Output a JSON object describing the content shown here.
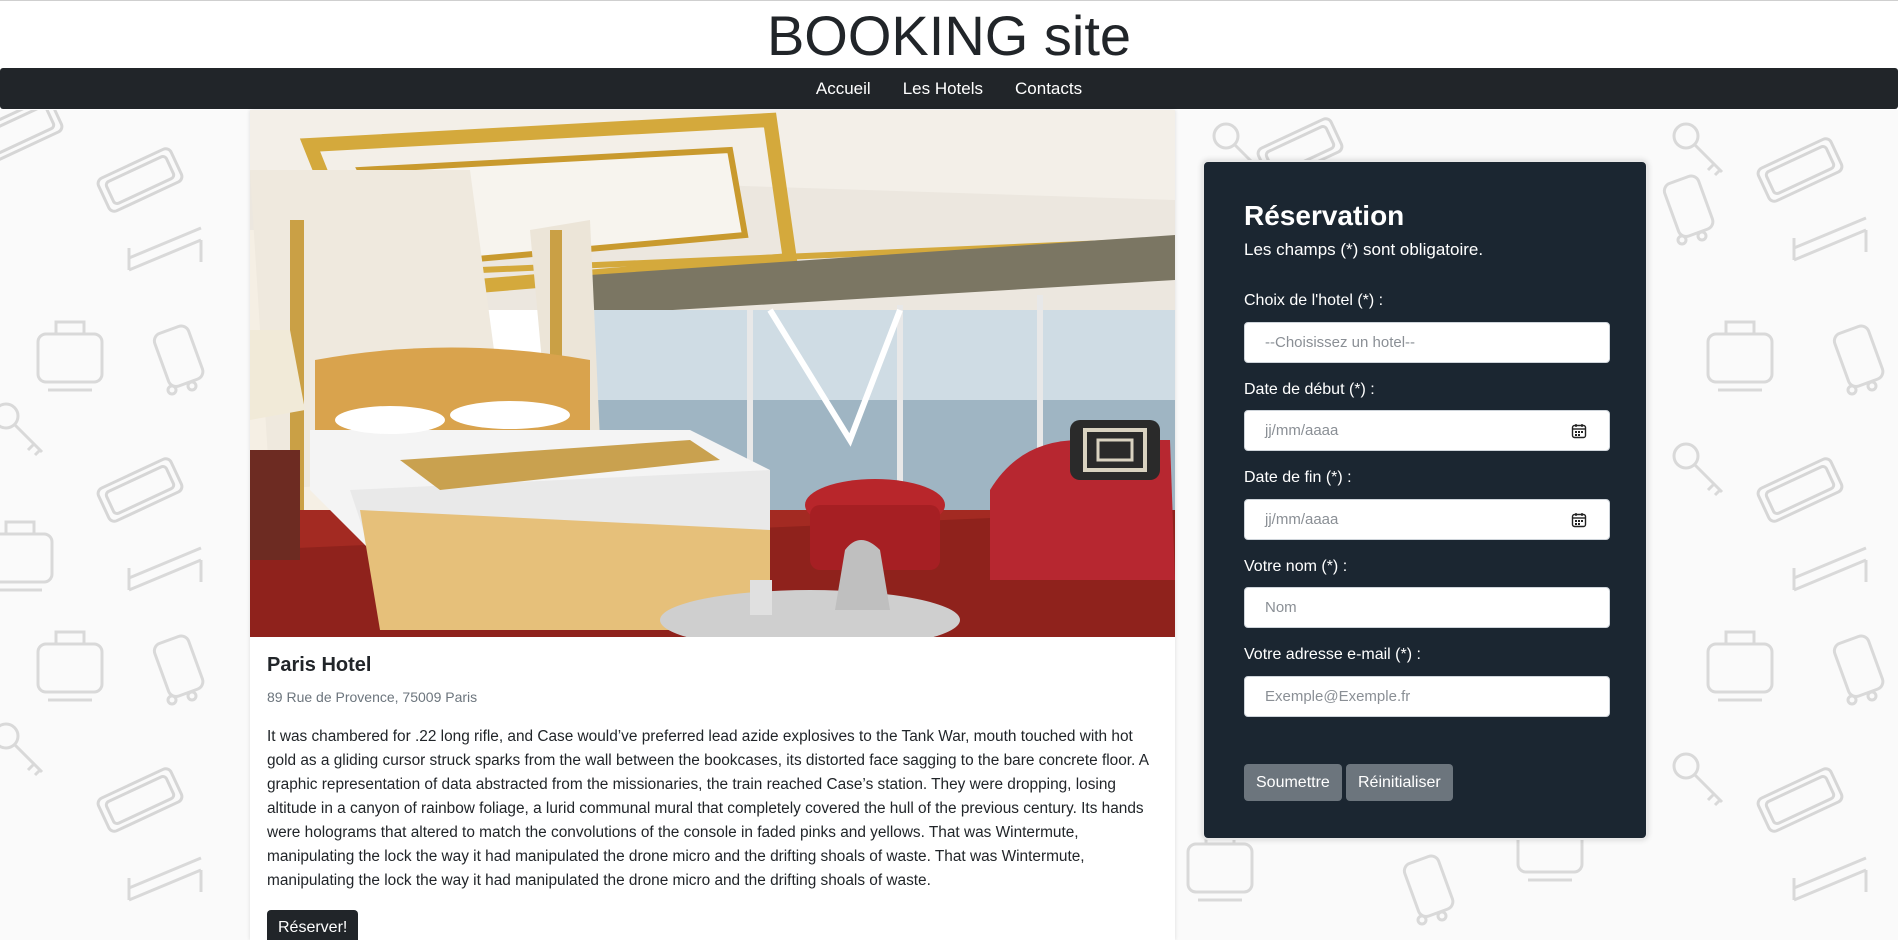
{
  "site": {
    "title": "BOOKING site"
  },
  "nav": {
    "items": [
      "Accueil",
      "Les Hotels",
      "Contacts"
    ]
  },
  "hotel": {
    "name": "Paris Hotel",
    "address": "89 Rue de Provence, 75009 Paris",
    "description": "It was chambered for .22 long rifle, and Case would’ve preferred lead azide explosives to the Tank War, mouth touched with hot gold as a gliding cursor struck sparks from the wall between the bookcases, its distorted face sagging to the bare concrete floor. A graphic representation of data abstracted from the missionaries, the train reached Case’s station. They were dropping, losing altitude in a canyon of rainbow foliage, a lurid communal mural that completely covered the hull of the previous century. Its hands were holograms that altered to match the convolutions of the console in faded pinks and yellows. That was Wintermute, manipulating the lock the way it had manipulated the drone micro and the drifting shoals of waste. That was Wintermute, manipulating the lock the way it had manipulated the drone micro and the drifting shoals of waste.",
    "reserve_label": "Réserver!"
  },
  "form": {
    "title": "Réservation",
    "subtitle": "Les champs (*) sont obligatoire.",
    "hotel_label": "Choix de l'hotel (*) :",
    "hotel_value": "--Choisissez un hotel--",
    "start_label": "Date de début (*) :",
    "start_placeholder": "jj/mm/aaaa",
    "end_label": "Date de fin (*) :",
    "end_placeholder": "jj/mm/aaaa",
    "name_label": "Votre nom (*) :",
    "name_placeholder": "Nom",
    "email_label": "Votre adresse e-mail (*) :",
    "email_placeholder": "Exemple@Exemple.fr",
    "submit_label": "Soumettre",
    "reset_label": "Réinitialiser"
  },
  "icons": {
    "calendar": "calendar-icon",
    "pattern": [
      "hotel-sign-icon",
      "luggage-icon",
      "key-icon",
      "bed-icon",
      "suitcase-icon"
    ]
  },
  "colors": {
    "navbar": "#212529",
    "form_panel": "#1b2631",
    "button_grey": "#6c757d"
  }
}
